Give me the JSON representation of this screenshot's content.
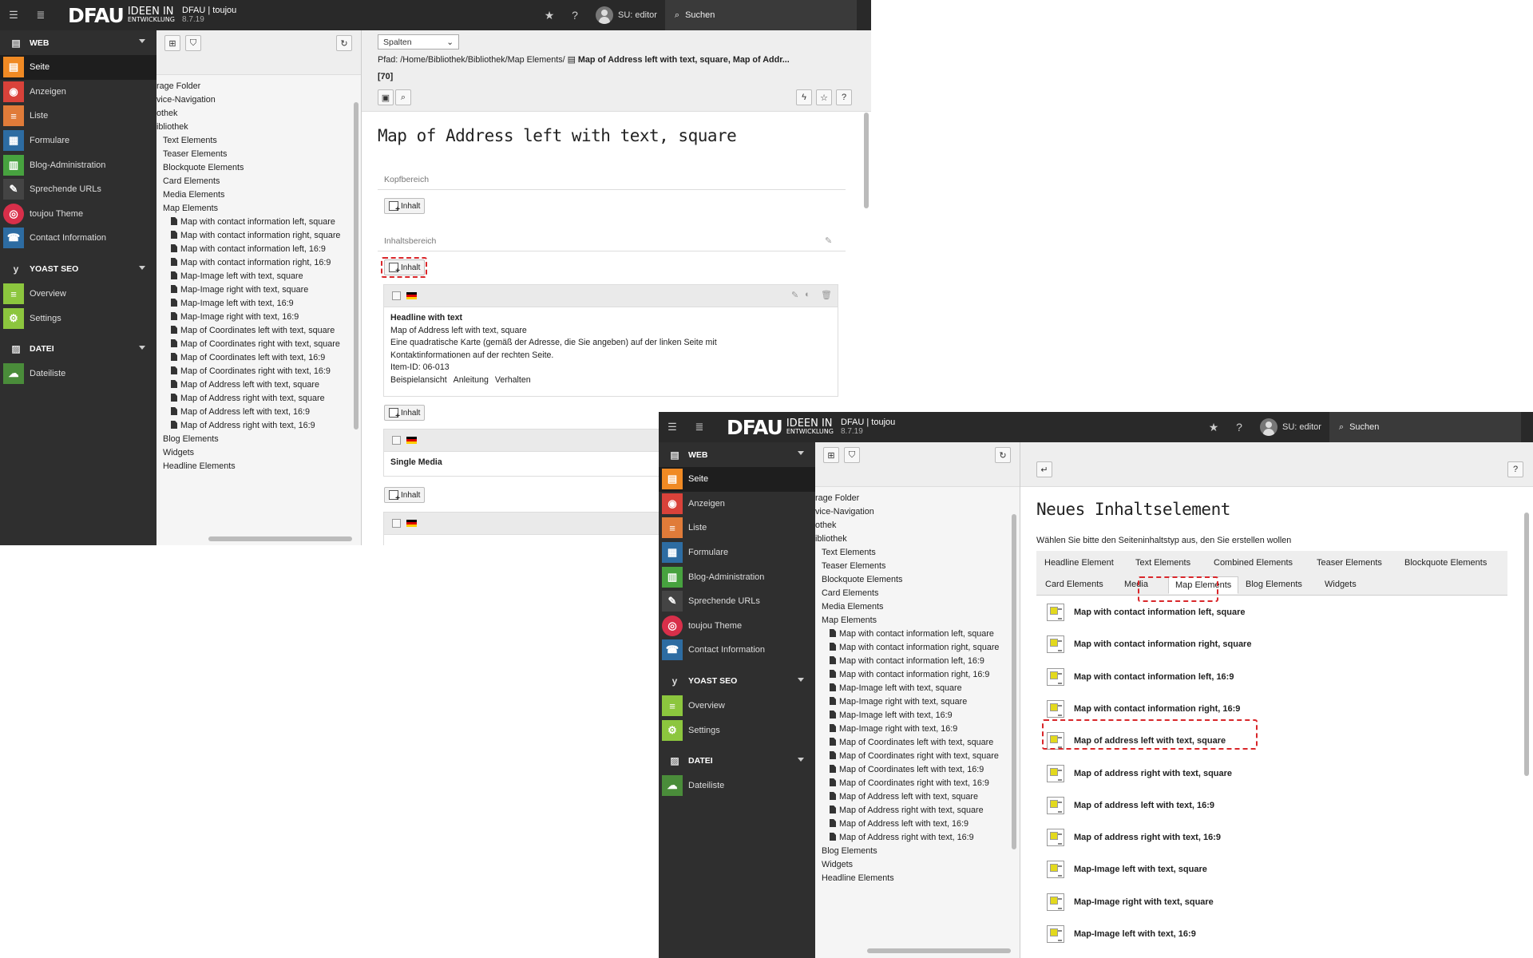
{
  "topbar": {
    "logo_main": "DFAU",
    "logo_sub1": "IDEEN IN",
    "logo_sub2": "ENTWICKLUNG",
    "site_name": "DFAU | toujou",
    "version": "8.7.19",
    "user": "SU: editor",
    "search": "Suchen"
  },
  "modules": {
    "web_group": "WEB",
    "web_items": [
      {
        "label": "Seite",
        "icon": "page-icon",
        "color": "#f08a24"
      },
      {
        "label": "Anzeigen",
        "icon": "eye-icon",
        "color": "#d9423a"
      },
      {
        "label": "Liste",
        "icon": "list-icon",
        "color": "#e07b39"
      },
      {
        "label": "Formulare",
        "icon": "form-icon",
        "color": "#2d6ca2"
      },
      {
        "label": "Blog-Administration",
        "icon": "blog-icon",
        "color": "#47a23f"
      },
      {
        "label": "Sprechende URLs",
        "icon": "pen-icon",
        "color": "#444444"
      },
      {
        "label": "toujou Theme",
        "icon": "fingerprint-icon",
        "color": "#d82f4a"
      },
      {
        "label": "Contact Information",
        "icon": "contact-icon",
        "color": "#2d6ca2"
      }
    ],
    "seo_group": "YOAST SEO",
    "seo_items": [
      {
        "label": "Overview",
        "icon": "overview-icon",
        "color": "#8cc63e"
      },
      {
        "label": "Settings",
        "icon": "settings-icon",
        "color": "#8cc63e"
      }
    ],
    "file_group": "DATEI",
    "file_items": [
      {
        "label": "Dateiliste",
        "icon": "filelist-icon",
        "color": "#4a8c3a"
      }
    ]
  },
  "tree": [
    {
      "label": "rage Folder",
      "level": 1
    },
    {
      "label": "vice-Navigation",
      "level": 1
    },
    {
      "label": "othek",
      "level": 1
    },
    {
      "label": "ibliothek",
      "level": 1
    },
    {
      "label": "Text Elements",
      "level": 2
    },
    {
      "label": "Teaser Elements",
      "level": 2
    },
    {
      "label": "Blockquote Elements",
      "level": 2
    },
    {
      "label": "Card Elements",
      "level": 2
    },
    {
      "label": "Media Elements",
      "level": 2
    },
    {
      "label": "Map Elements",
      "level": 2
    },
    {
      "label": "Map with contact information left, square",
      "level": 3
    },
    {
      "label": "Map with contact information right, square",
      "level": 3
    },
    {
      "label": "Map with contact information left, 16:9",
      "level": 3
    },
    {
      "label": "Map with contact information right, 16:9",
      "level": 3
    },
    {
      "label": "Map-Image left with text, square",
      "level": 3
    },
    {
      "label": "Map-Image right with text, square",
      "level": 3
    },
    {
      "label": "Map-Image left with text, 16:9",
      "level": 3
    },
    {
      "label": "Map-Image right with text, 16:9",
      "level": 3
    },
    {
      "label": "Map of Coordinates left with text, square",
      "level": 3
    },
    {
      "label": "Map of Coordinates right with text, square",
      "level": 3
    },
    {
      "label": "Map of Coordinates left with text, 16:9",
      "level": 3
    },
    {
      "label": "Map of Coordinates right with text, 16:9",
      "level": 3
    },
    {
      "label": "Map of Address left with text, square",
      "level": 3
    },
    {
      "label": "Map of Address right with text, square",
      "level": 3
    },
    {
      "label": "Map of Address left with text, 16:9",
      "level": 3
    },
    {
      "label": "Map of Address right with text, 16:9",
      "level": 3
    },
    {
      "label": "Blog Elements",
      "level": 2
    },
    {
      "label": "Widgets",
      "level": 2
    },
    {
      "label": "Headline Elements",
      "level": 2
    }
  ],
  "page": {
    "columns_select": "Spalten",
    "path_prefix": "Pfad: /Home/Bibliothek/Bibliothek/Map Elements/",
    "path_title": "Map of Address left with text, square, Map of Addr...",
    "page_id": "[70]",
    "title": "Map of Address left with text, square",
    "kopf_label": "Kopfbereich",
    "inhalt_label": "Inhaltsbereich",
    "add_content": "Inhalt",
    "ce1": {
      "headline": "Headline with text",
      "line1": "Map of Address left with text, square",
      "line2": "Eine quadratische Karte (gemäß der Adresse, die Sie angeben) auf der linken Seite mit",
      "line3": "Kontaktinformationen auf der rechten Seite.",
      "line4": "Item-ID: 06-013",
      "link1": "Beispielansicht",
      "link2": "Anleitung",
      "link3": "Verhalten"
    },
    "ce2": {
      "headline": "Single Media"
    }
  },
  "wizard": {
    "title": "Neues Inhaltselement",
    "subtitle": "Wählen Sie bitte den Seiteninhaltstyp aus, den Sie erstellen wollen",
    "tabs_row1": [
      "Headline Element",
      "Text Elements",
      "Combined Elements",
      "Teaser Elements",
      "Blockquote Elements"
    ],
    "tabs_row2": [
      "Card Elements",
      "Media",
      "Map Elements",
      "Blog Elements",
      "Widgets"
    ],
    "active_tab": "Map Elements",
    "items": [
      "Map with contact information left, square",
      "Map with contact information right, square",
      "Map with contact information left, 16:9",
      "Map with contact information right, 16:9",
      "Map of address left with text, square",
      "Map of address right with text, square",
      "Map of address left with text, 16:9",
      "Map of address right with text, 16:9",
      "Map-Image left with text, square",
      "Map-Image right with text, square",
      "Map-Image left with text, 16:9"
    ],
    "highlighted_item": "Map of address left with text, square",
    "highlight_color": "#d9262a"
  }
}
